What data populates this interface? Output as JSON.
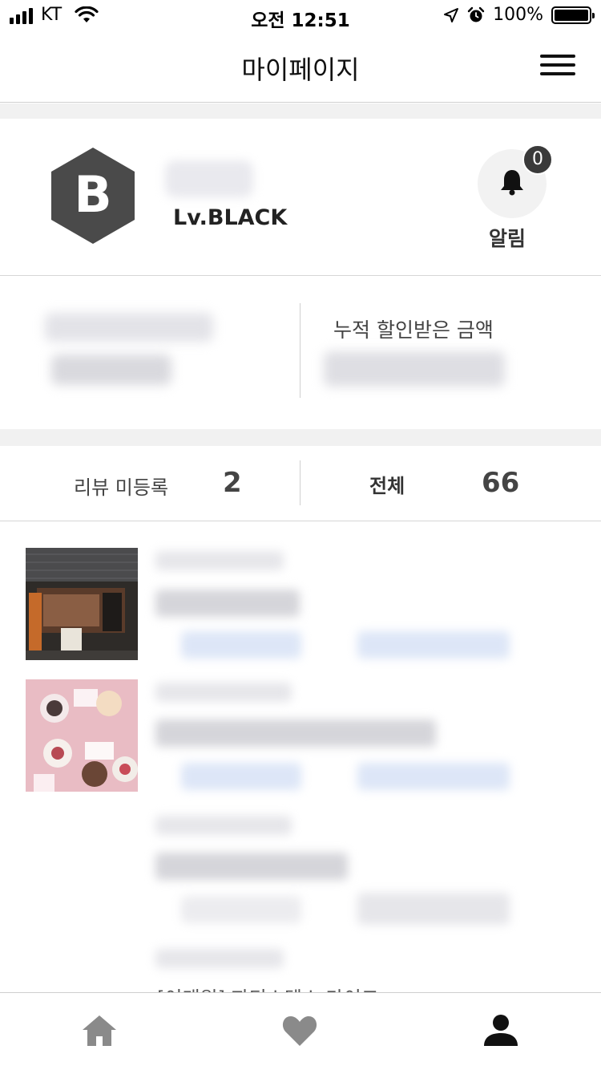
{
  "status_bar": {
    "carrier": "KT",
    "time": "오전 12:51",
    "battery": "100%"
  },
  "header": {
    "title": "마이페이지"
  },
  "profile": {
    "avatar_letter": "B",
    "level": "Lv.BLACK",
    "alarm_label": "알림",
    "alarm_count": "0"
  },
  "savings": {
    "cumulative_discount_label": "누적 할인받은 금액"
  },
  "review_tabs": {
    "pending_label": "리뷰 미등록",
    "pending_count": "2",
    "all_label": "전체",
    "all_count": "66"
  },
  "review_list": {
    "peek_text": "[이태원] 파티스텐스 마이코"
  },
  "icons": {
    "home": "home-icon",
    "heart": "heart-icon",
    "my": "person-icon",
    "menu": "hamburger-menu-icon",
    "bell": "bell-icon"
  },
  "colors": {
    "accent_dark": "#4a4a4a",
    "icon_gray": "#8a8a8a",
    "badge": "#3a3a3a"
  }
}
